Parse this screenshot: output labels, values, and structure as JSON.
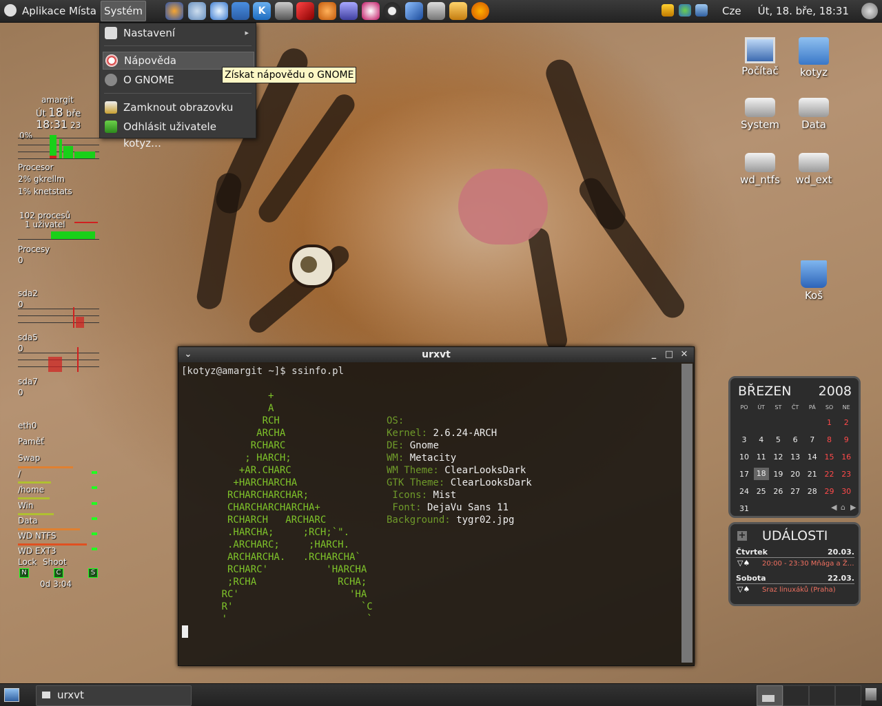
{
  "top_panel": {
    "menus": [
      "Aplikace",
      "Místa",
      "Systém"
    ],
    "launchers": [
      "firefox-icon",
      "sphere-icon",
      "bulb-icon",
      "network-icon",
      "k-icon",
      "monitor-icon",
      "pencil-icon",
      "shell-icon",
      "cursor-icon",
      "penguin-icon",
      "disc-icon",
      "guitar-icon",
      "video-icon",
      "clapper-icon",
      "pac-icon"
    ],
    "keyboard": "Cze",
    "clock": "Út, 18. bře, 18:31"
  },
  "system_menu": {
    "items": [
      {
        "label": "Nastavení",
        "icon": "settings-icon",
        "submenu": true
      },
      {
        "label": "Nápověda",
        "icon": "help-lifebuoy-icon",
        "highlighted": true
      },
      {
        "label": "O GNOME",
        "icon": "gnome-foot-icon"
      },
      {
        "label": "Zamknout obrazovku",
        "icon": "lock-icon"
      },
      {
        "label": "Odhlásit uživatele kotyz…",
        "icon": "logout-run-icon"
      }
    ],
    "tooltip": "Získat nápovědu o GNOME"
  },
  "conky": {
    "host": "amargit",
    "day": "Út",
    "date_num": "18",
    "month": "bře",
    "time": "18:31",
    "seconds": "23",
    "cpu_pct": "0%",
    "cpu_label": "Procesor",
    "top1": "2% gkrellm",
    "top2": "1% knetstats",
    "procs": "102 procesů",
    "users": "1 uživatel",
    "procs_label": "Procesy",
    "procs_value": "0",
    "sda2": "sda2",
    "sda2_val": "0",
    "sda5": "sda5",
    "sda5_val": "0",
    "sda7": "sda7",
    "sda7_val": "0",
    "eth0": "eth0",
    "mem": "Paměť",
    "swap": "Swap",
    "root": "/",
    "home": "/home",
    "win": "Win",
    "data": "Data",
    "wdntfs": "WD NTFS",
    "wdext3": "WD EXT3",
    "lock": "Lock",
    "shoot": "Shoot",
    "lock_n": "N",
    "lock_c": "C",
    "lock_s": "S",
    "uptime": "0d  3:04"
  },
  "desktop_icons": [
    {
      "label": "Počítač",
      "icon": "computer-icon"
    },
    {
      "label": "kotyz",
      "icon": "home-folder-icon"
    },
    {
      "label": "System",
      "icon": "drive-icon"
    },
    {
      "label": "Data",
      "icon": "drive-icon"
    },
    {
      "label": "wd_ntfs",
      "icon": "drive-icon"
    },
    {
      "label": "wd_ext",
      "icon": "drive-icon"
    },
    {
      "label": "Koš",
      "icon": "trash-icon"
    }
  ],
  "terminal": {
    "title": "urxvt",
    "prompt": "[kotyz@amargit ~]$ ssinfo.pl",
    "logo": [
      "        +",
      "        A",
      "       RCH",
      "      ARCHA",
      "     RCHARC",
      "    ; HARCH;",
      "   +AR.CHARC",
      "  +HARCHARCHA",
      " RCHARCHARCHAR;",
      " CHARCHARCHARCHA+",
      " RCHARCH   ARCHARC",
      " .HARCHA;     ;RCH;`\".",
      " .ARCHARC;     ;HARCH.",
      " ARCHARCHA.   .RCHARCHA`",
      " RCHARC'          'HARCHA",
      " ;RCHA              RCHA;",
      "RC'                   'HA",
      "R'                      `C",
      "'                        `"
    ],
    "info": [
      {
        "label": "OS:",
        "value": ""
      },
      {
        "label": "Kernel:",
        "value": "2.6.24-ARCH"
      },
      {
        "label": "DE:",
        "value": "Gnome"
      },
      {
        "label": "WM:",
        "value": "Metacity"
      },
      {
        "label": "WM Theme:",
        "value": "ClearLooksDark"
      },
      {
        "label": "GTK Theme:",
        "value": "ClearLooksDark"
      },
      {
        "label": " Icons:",
        "value": "Mist"
      },
      {
        "label": " Font:",
        "value": "DejaVu Sans 11"
      },
      {
        "label": "Background:",
        "value": "tygr02.jpg"
      }
    ]
  },
  "calendar": {
    "month": "BŘEZEN",
    "year": "2008",
    "day_names": [
      "PO",
      "ÚT",
      "ST",
      "ČT",
      "PÁ",
      "SO",
      "NE"
    ],
    "weeks": [
      [
        "",
        "",
        "",
        "",
        "",
        "1",
        "2"
      ],
      [
        "3",
        "4",
        "5",
        "6",
        "7",
        "8",
        "9"
      ],
      [
        "10",
        "11",
        "12",
        "13",
        "14",
        "15",
        "16"
      ],
      [
        "17",
        "18",
        "19",
        "20",
        "21",
        "22",
        "23"
      ],
      [
        "24",
        "25",
        "26",
        "27",
        "28",
        "29",
        "30"
      ],
      [
        "31",
        "",
        "",
        "",
        "",
        "",
        ""
      ]
    ],
    "today": "18"
  },
  "events": {
    "title": "UDÁLOSTI",
    "items": [
      {
        "day": "Čtvrtek",
        "date": "20.03.",
        "text": "20:00 - 23:30 Mňága a Ž…"
      },
      {
        "day": "Sobota",
        "date": "22.03.",
        "text": "Sraz linuxáků (Praha)"
      }
    ]
  },
  "bottom_panel": {
    "task": "urxvt"
  }
}
